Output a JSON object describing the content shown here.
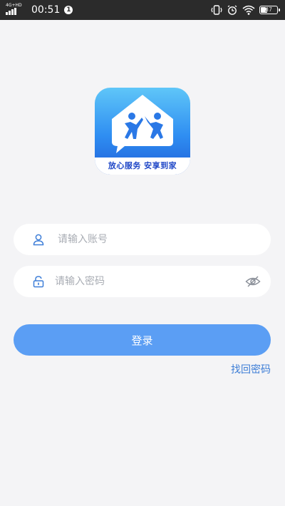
{
  "status_bar": {
    "network_label": "4G+HD",
    "time": "00:51",
    "notification_count": "1",
    "battery_level": "37"
  },
  "logo": {
    "slogan": "放心服务 安享到家"
  },
  "login_form": {
    "account_placeholder": "请输入账号",
    "password_placeholder": "请输入密码",
    "login_label": "登录",
    "forgot_password_label": "找回密码"
  },
  "colors": {
    "primary_button": "#5b9ef4",
    "link": "#3c7dd6",
    "background": "#f4f4f6"
  }
}
